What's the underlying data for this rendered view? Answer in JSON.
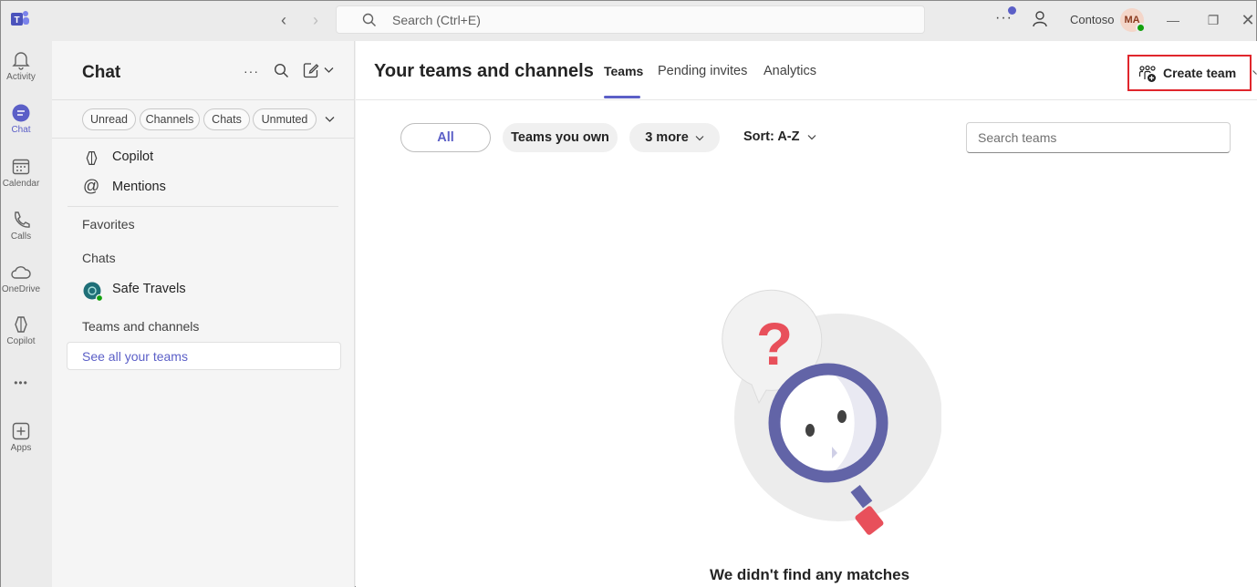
{
  "titlebar": {
    "search_placeholder": "Search (Ctrl+E)",
    "more": "···",
    "org_name": "Contoso",
    "avatar_initials": "MA"
  },
  "rail": {
    "items": [
      {
        "label": "Activity",
        "icon": "bell-icon"
      },
      {
        "label": "Chat",
        "icon": "chat-icon"
      },
      {
        "label": "Calendar",
        "icon": "calendar-icon"
      },
      {
        "label": "Calls",
        "icon": "phone-icon"
      },
      {
        "label": "OneDrive",
        "icon": "cloud-icon"
      },
      {
        "label": "Copilot",
        "icon": "copilot-icon"
      },
      {
        "label": "",
        "icon": "more-icon"
      },
      {
        "label": "Apps",
        "icon": "add-app-icon"
      }
    ],
    "more_glyph": "•••"
  },
  "leftpane": {
    "title": "Chat",
    "more_glyph": "···",
    "filters": [
      "Unread",
      "Channels",
      "Chats",
      "Unmuted"
    ],
    "items": [
      {
        "label": "Copilot",
        "icon": "copilot-icon"
      },
      {
        "label": "Mentions",
        "icon": "at-icon"
      }
    ],
    "sections": {
      "favorites": "Favorites",
      "chats": "Chats",
      "teams_and_channels": "Teams and channels"
    },
    "chat_items": [
      {
        "label": "Safe Travels",
        "icon": "group-avatar-icon"
      }
    ],
    "see_all": "See all your teams"
  },
  "main": {
    "title": "Your teams and channels",
    "tabs": [
      {
        "label": "Teams",
        "active": true
      },
      {
        "label": "Pending invites",
        "active": false
      },
      {
        "label": "Analytics",
        "active": false
      }
    ],
    "create_team": "Create team",
    "filters": {
      "all": "All",
      "own": "Teams you own",
      "more": "3 more",
      "sort": "Sort: A-Z"
    },
    "search_placeholder": "Search teams",
    "empty_message": "We didn't find any matches",
    "empty_glyph": "?"
  },
  "colors": {
    "accent": "#5b5fc7",
    "highlight_border": "#e0262c",
    "presence": "#13a10e",
    "magnifier": "#6264a7",
    "question": "#e8505b"
  }
}
